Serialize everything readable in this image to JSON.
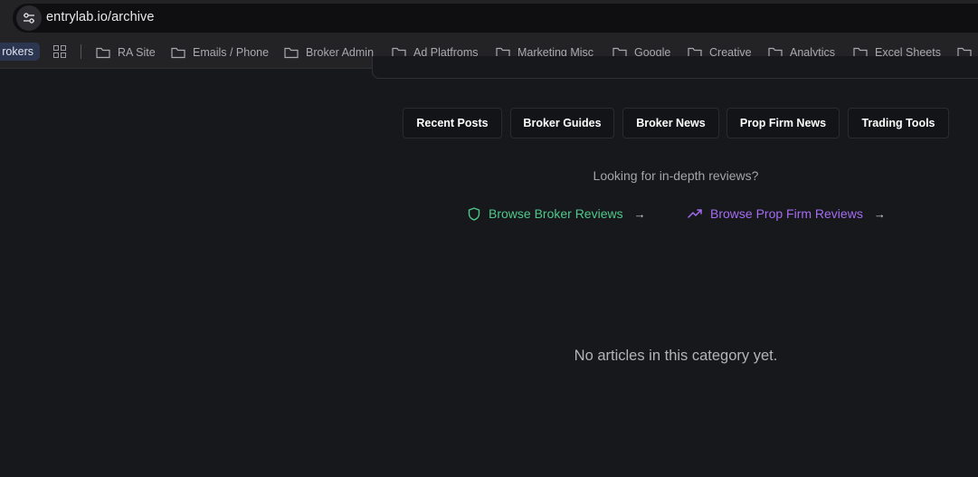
{
  "browser": {
    "url": "entrylab.io/archive",
    "bookmarks_first_chip": "rokers",
    "bookmarks": [
      {
        "label": "RA Site"
      },
      {
        "label": "Emails / Phone"
      },
      {
        "label": "Broker Admin"
      },
      {
        "label": "Ad Platfroms"
      },
      {
        "label": "Marketing Misc"
      },
      {
        "label": "Google"
      },
      {
        "label": "Creative"
      },
      {
        "label": "Analytics"
      },
      {
        "label": "Excel Sheets"
      },
      {
        "label": ""
      }
    ]
  },
  "tabs": [
    {
      "label": "Recent Posts"
    },
    {
      "label": "Broker Guides"
    },
    {
      "label": "Broker News"
    },
    {
      "label": "Prop Firm News"
    },
    {
      "label": "Trading Tools"
    }
  ],
  "reviews": {
    "prompt": "Looking for in-depth reviews?",
    "broker_link": "Browse Broker Reviews",
    "prop_link": "Browse Prop Firm Reviews",
    "arrow": "→"
  },
  "empty_state": "No articles in this category yet.",
  "colors": {
    "broker_link": "#4ec98a",
    "prop_link": "#a46cf0",
    "background": "#17181c"
  }
}
